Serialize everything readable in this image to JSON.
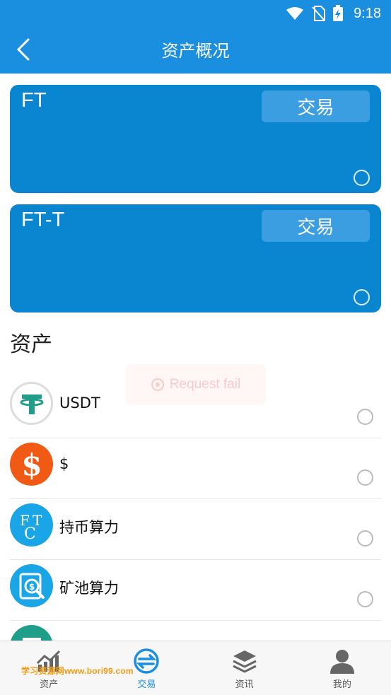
{
  "status_bar": {
    "time": "9:18"
  },
  "header": {
    "title": "资产概况"
  },
  "cards": [
    {
      "name": "FT",
      "trade_label": "交易"
    },
    {
      "name": "FT-T",
      "trade_label": "交易"
    }
  ],
  "section": {
    "title": "资产"
  },
  "toast": {
    "text": "Request fail"
  },
  "assets": [
    {
      "label": "USDT"
    },
    {
      "label": "$"
    },
    {
      "label": "持币算力"
    },
    {
      "label": "矿池算力"
    }
  ],
  "bottom_nav": [
    {
      "label": "资产"
    },
    {
      "label": "交易"
    },
    {
      "label": "资讯"
    },
    {
      "label": "我的"
    }
  ],
  "watermark": "学习资源网www.bori99.com",
  "colors": {
    "primary": "#1a8fe0",
    "card": "#0a86d0",
    "dollar": "#f05a14",
    "usdt": "#1f9e8a",
    "ft_blue": "#19a5e6"
  }
}
